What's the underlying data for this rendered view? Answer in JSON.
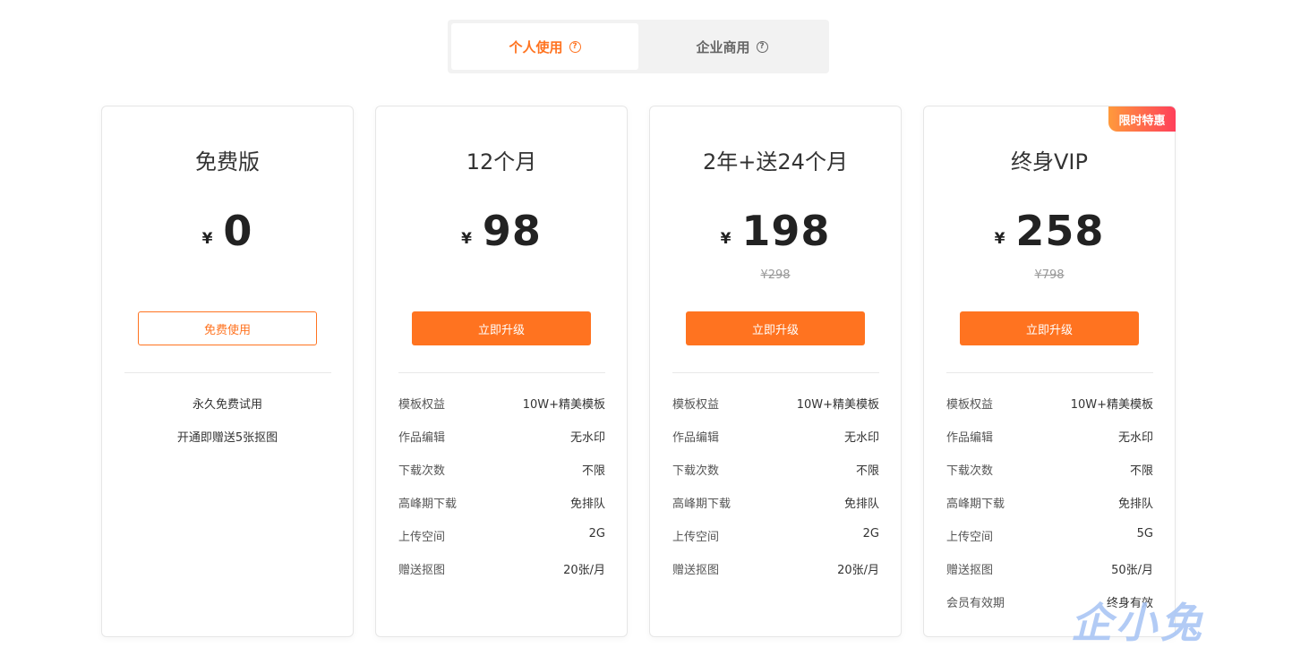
{
  "tabs": [
    {
      "label": "个人使用",
      "active": true
    },
    {
      "label": "企业商用",
      "active": false
    }
  ],
  "help_icon": "?",
  "currency": "¥",
  "cards": [
    {
      "title": "免费版",
      "price": "0",
      "button": "免费使用",
      "lines": [
        "永久免费试用",
        "开通即赠送5张抠图"
      ]
    },
    {
      "title": "12个月",
      "price": "98",
      "button": "立即升级",
      "features": [
        {
          "k": "模板权益",
          "v": "10W+精美模板"
        },
        {
          "k": "作品编辑",
          "v": "无水印"
        },
        {
          "k": "下载次数",
          "v": "不限"
        },
        {
          "k": "高峰期下载",
          "v": "免排队"
        },
        {
          "k": "上传空间",
          "v": "2G"
        },
        {
          "k": "赠送抠图",
          "v": "20张/月"
        }
      ]
    },
    {
      "title": "2年+送24个月",
      "price": "198",
      "original": "¥298",
      "button": "立即升级",
      "features": [
        {
          "k": "模板权益",
          "v": "10W+精美模板"
        },
        {
          "k": "作品编辑",
          "v": "无水印"
        },
        {
          "k": "下载次数",
          "v": "不限"
        },
        {
          "k": "高峰期下载",
          "v": "免排队"
        },
        {
          "k": "上传空间",
          "v": "2G"
        },
        {
          "k": "赠送抠图",
          "v": "20张/月"
        }
      ]
    },
    {
      "title": "终身VIP",
      "price": "258",
      "original": "¥798",
      "button": "立即升级",
      "badge": "限时特惠",
      "features": [
        {
          "k": "模板权益",
          "v": "10W+精美模板"
        },
        {
          "k": "作品编辑",
          "v": "无水印"
        },
        {
          "k": "下载次数",
          "v": "不限"
        },
        {
          "k": "高峰期下载",
          "v": "免排队"
        },
        {
          "k": "上传空间",
          "v": "5G"
        },
        {
          "k": "赠送抠图",
          "v": "50张/月"
        },
        {
          "k": "会员有效期",
          "v": "终身有效"
        }
      ]
    }
  ],
  "watermark": "企小兔",
  "colors": {
    "accent": "#ff7320",
    "badge_start": "#ff9a3c",
    "badge_end": "#ff3f5a"
  }
}
